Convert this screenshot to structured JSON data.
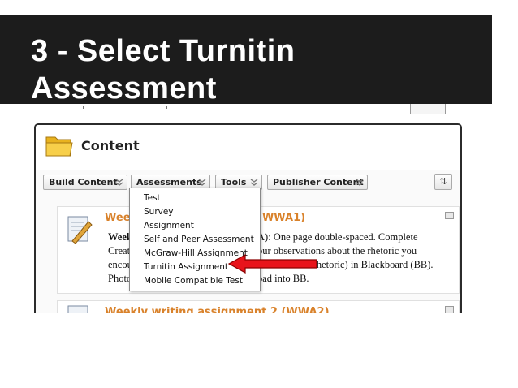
{
  "slide": {
    "title_line1": "3 - Select Turnitin",
    "title_line2": "Assessment"
  },
  "panel": {
    "title": "Content",
    "icons": {
      "folder": "folder-icon",
      "sort": "sort-icon"
    }
  },
  "toolbar": {
    "build_content": "Build Content",
    "assessments": "Assessments",
    "tools": "Tools",
    "publisher_content": "Publisher Content",
    "sort_label": "⇅"
  },
  "menu": {
    "items": [
      "Test",
      "Survey",
      "Assignment",
      "Self and Peer Assessment",
      "McGraw-Hill Assignment",
      "Turnitin Assignment",
      "Mobile Compatible Test"
    ],
    "highlighted": "Turnitin Assignment"
  },
  "content_item": {
    "link_start": "Week",
    "link_end": "(WWA1)",
    "body_left": [
      "Week",
      "Creat",
      "encou",
      "Photo"
    ],
    "body_right": [
      "A): One page double-spaced. Complete",
      "our observations about the rhetoric you",
      "a rhetoric) in Blackboard (BB).",
      "oad into BB."
    ]
  },
  "content_item_2": {
    "link": "Weekly writing assignment 2 (WWA2)"
  },
  "colors": {
    "title_bg": "#1c1c1c",
    "link": "#d9822b",
    "arrow": "#e8141b"
  }
}
